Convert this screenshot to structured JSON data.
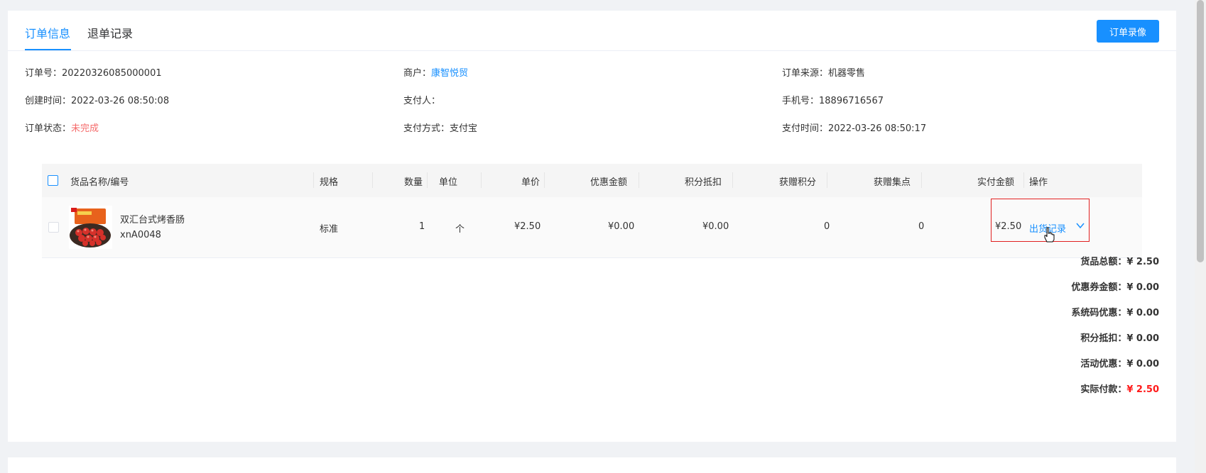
{
  "tabs": [
    {
      "label": "订单信息",
      "active": true
    },
    {
      "label": "退单记录",
      "active": false
    }
  ],
  "video_button": "订单录像",
  "info": {
    "order_no_label": "订单号：",
    "order_no": "20220326085000001",
    "merchant_label": "商户：",
    "merchant": "康智悦贸",
    "source_label": "订单来源：",
    "source": "机器零售",
    "created_label": "创建时间：",
    "created": "2022-03-26 08:50:08",
    "payer_label": "支付人：",
    "payer": "",
    "phone_label": "手机号：",
    "phone": "18896716567",
    "status_label": "订单状态：",
    "status": "未完成",
    "pay_method_label": "支付方式：",
    "pay_method": "支付宝",
    "pay_time_label": "支付时间：",
    "pay_time": "2022-03-26 08:50:17"
  },
  "table": {
    "headers": [
      "货品名称/编号",
      "规格",
      "数量",
      "单位",
      "单价",
      "优惠金额",
      "积分抵扣",
      "获赠积分",
      "获赠集点",
      "实付金额",
      "操作"
    ],
    "rows": [
      {
        "name": "双汇台式烤香肠",
        "code": "xnA0048",
        "spec": "标准",
        "qty": "1",
        "unit": "个",
        "price": "¥2.50",
        "discount": "¥0.00",
        "points_deduct": "¥0.00",
        "gift_points": "0",
        "gift_stamps": "0",
        "paid": "¥2.50",
        "action": "出货记录"
      }
    ]
  },
  "summary": [
    {
      "label": "货品总额：",
      "value": "¥ 2.50",
      "highlight": false
    },
    {
      "label": "优惠券金额：",
      "value": "¥ 0.00",
      "highlight": false
    },
    {
      "label": "系统码优惠：",
      "value": "¥ 0.00",
      "highlight": false
    },
    {
      "label": "积分抵扣：",
      "value": "¥ 0.00",
      "highlight": false
    },
    {
      "label": "活动优惠：",
      "value": "¥ 0.00",
      "highlight": false
    },
    {
      "label": "实际付款：",
      "value": "¥ 2.50",
      "highlight": true
    }
  ],
  "colors": {
    "accent": "#1890ff",
    "danger": "#f56c6c",
    "total_red": "#ff1a1a"
  }
}
